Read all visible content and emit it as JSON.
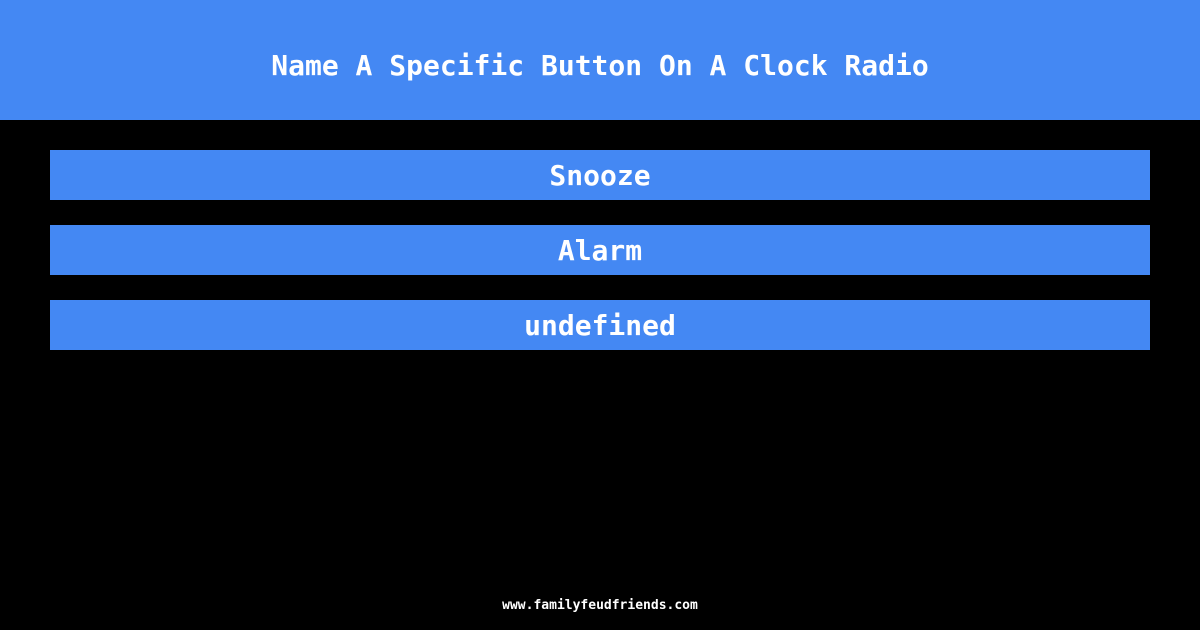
{
  "header": {
    "question": "Name A Specific Button On A Clock Radio"
  },
  "answers": [
    {
      "label": "Snooze"
    },
    {
      "label": "Alarm"
    },
    {
      "label": "undefined"
    }
  ],
  "footer": {
    "site": "www.familyfeudfriends.com"
  },
  "colors": {
    "accent": "#4488f3",
    "background": "#000000",
    "text": "#ffffff"
  }
}
